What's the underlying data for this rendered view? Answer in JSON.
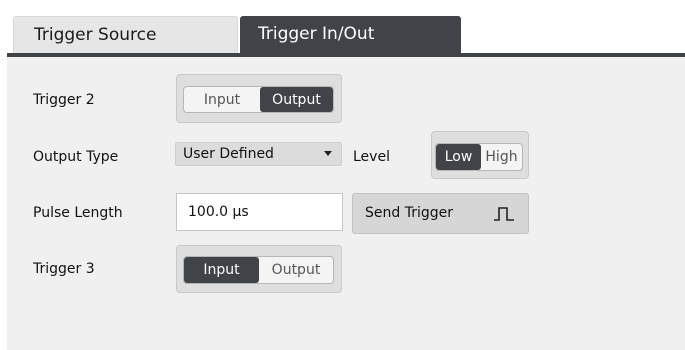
{
  "tabs": [
    {
      "label": "Trigger Source",
      "active": false
    },
    {
      "label": "Trigger In/Out",
      "active": true
    }
  ],
  "trigger2": {
    "label": "Trigger 2",
    "options": [
      "Input",
      "Output"
    ],
    "selected": "Output"
  },
  "output_type": {
    "label": "Output Type",
    "value": "User Defined"
  },
  "level": {
    "label": "Level",
    "options": [
      "Low",
      "High"
    ],
    "selected": "Low"
  },
  "pulse_length": {
    "label": "Pulse Length",
    "value": "100.0 µs"
  },
  "send_trigger": {
    "label": "Send Trigger",
    "icon": "pulse-icon"
  },
  "trigger3": {
    "label": "Trigger 3",
    "options": [
      "Input",
      "Output"
    ],
    "selected": "Input"
  },
  "colors": {
    "accent": "#404347",
    "panel": "#f0f0f0",
    "button": "#d6d6d6"
  }
}
